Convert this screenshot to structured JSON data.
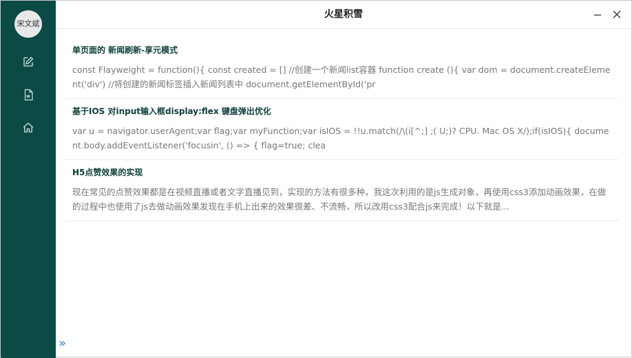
{
  "window": {
    "title": "火星积雪"
  },
  "sidebar": {
    "avatar_text": "宋文斌",
    "icons": [
      {
        "name": "edit-icon"
      },
      {
        "name": "document-icon"
      },
      {
        "name": "home-icon"
      }
    ],
    "expand_glyph": "»"
  },
  "articles": [
    {
      "title": "单页面的 新闻刷新-享元模式",
      "desc": "const Flayweight = function(){ const created = [] //创建一个新闻list容器 function create (){ var dom = document.createElement('div') //将创建的新闻标签插入新闻列表中 document.getElementById('pr"
    },
    {
      "title": "基于IOS 对input输入框display:flex 键盘弹出优化",
      "desc": "var u = navigator.userAgent;var flag;var myFunction;var isIOS = !!u.match(/\\(i[^;] ;( U;)? CPU. Mac OS X/);if(isIOS){ document.body.addEventListener('focusin', () => { flag=true; clea"
    },
    {
      "title": "H5点赞效果的实现",
      "desc": "现在常见的点赞效果都是在视频直播或者文字直播见到，实现的方法有很多种，我这次利用的是js生成对象，再使用css3添加动画效果，在做的过程中也使用了js去做动画效果发现在手机上出来的效果很差、不流畅，所以改用css3配合js来完成！以下就是..."
    }
  ]
}
